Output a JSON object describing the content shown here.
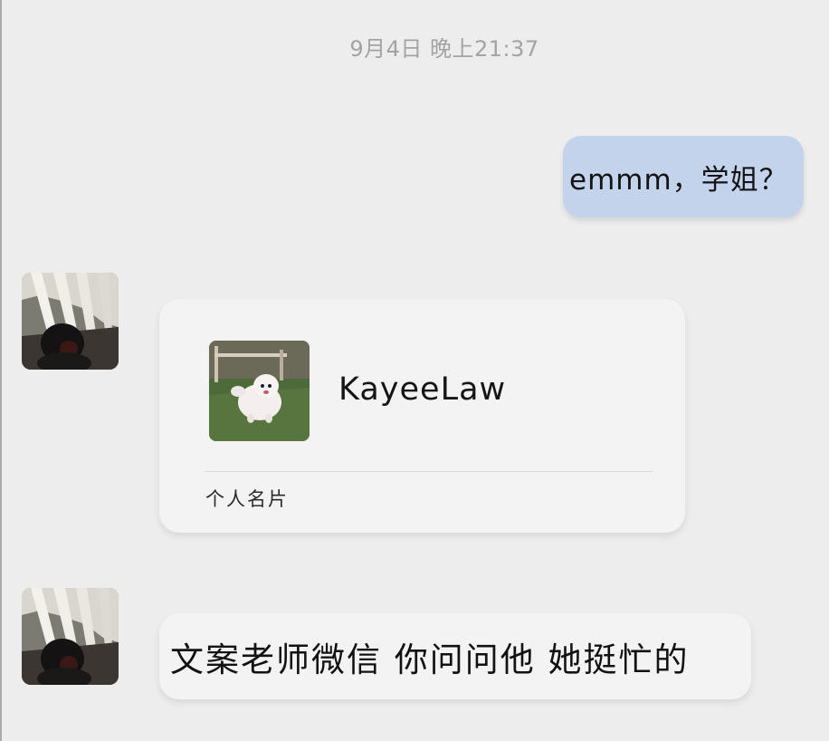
{
  "chat": {
    "timestamp": "9月4日 晚上21:37",
    "messages": [
      {
        "direction": "outgoing",
        "text": "emmm，学姐？"
      },
      {
        "direction": "incoming",
        "type": "contact-card",
        "card": {
          "name": "KayeeLaw",
          "label": "个人名片"
        }
      },
      {
        "direction": "incoming",
        "text": "文案老师微信 你问问他 她挺忙的"
      }
    ]
  },
  "colors": {
    "background": "#ededed",
    "outgoing_bubble": "#c4d3ec",
    "incoming_bubble": "#f3f3f3",
    "timestamp": "#a3a3a3"
  },
  "icons": {
    "avatar": "user-avatar-photo",
    "card_photo": "dog-photo"
  }
}
